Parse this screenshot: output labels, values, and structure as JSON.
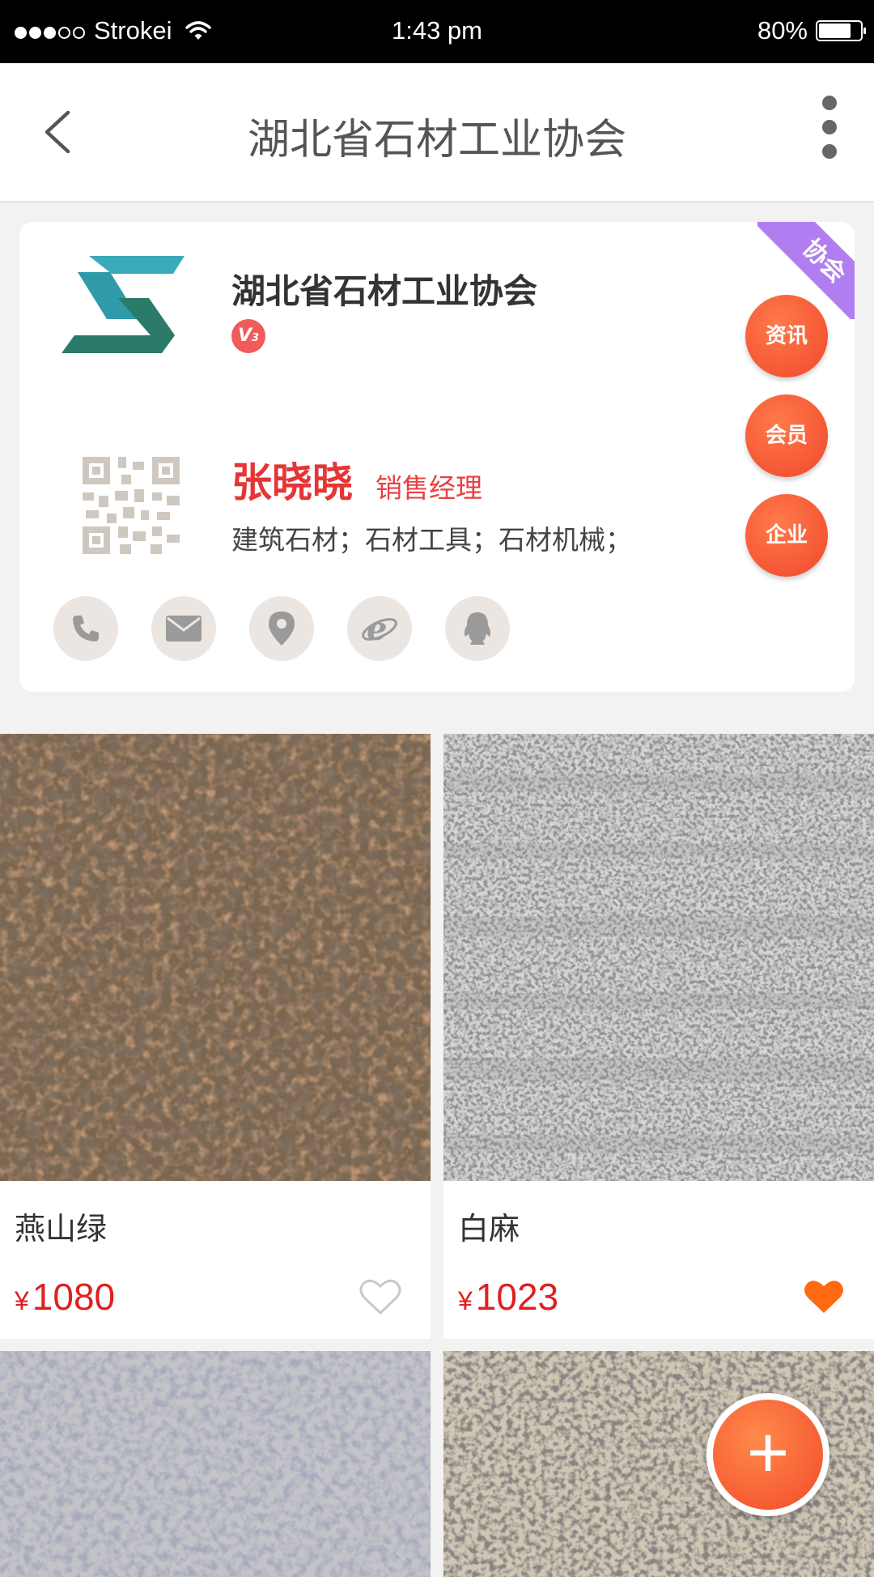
{
  "status_bar": {
    "carrier": "Strokei",
    "time": "1:43 pm",
    "battery": "80%",
    "battery_level": 0.8,
    "signal_dots_filled": 3,
    "signal_dots_total": 5
  },
  "nav": {
    "title": "湖北省石材工业协会",
    "back_icon": "chevron-left-icon",
    "more_icon": "more-vertical-icon"
  },
  "profile": {
    "org_name": "湖北省石材工业协会",
    "level_badge": "V",
    "level_number": "3",
    "ribbon_label": "协会",
    "contact_name": "张晓晓",
    "contact_title": "销售经理",
    "tags": "建筑石材；石材工具；石材机械；",
    "side_buttons": [
      {
        "label": "资讯"
      },
      {
        "label": "会员"
      },
      {
        "label": "企业"
      }
    ],
    "contact_icons": [
      "phone-icon",
      "mail-icon",
      "location-icon",
      "browser-icon",
      "qq-icon"
    ]
  },
  "products": [
    {
      "name": "燕山绿",
      "currency": "¥",
      "price": "1080",
      "favorited": false
    },
    {
      "name": "白麻",
      "currency": "¥",
      "price": "1023",
      "favorited": true
    }
  ],
  "colors": {
    "accent_red": "#e53535",
    "button_orange": "#f0482c",
    "ribbon_purple": "#b07ef0",
    "heart_orange": "#ff6a10"
  },
  "fab": {
    "label": "+"
  }
}
